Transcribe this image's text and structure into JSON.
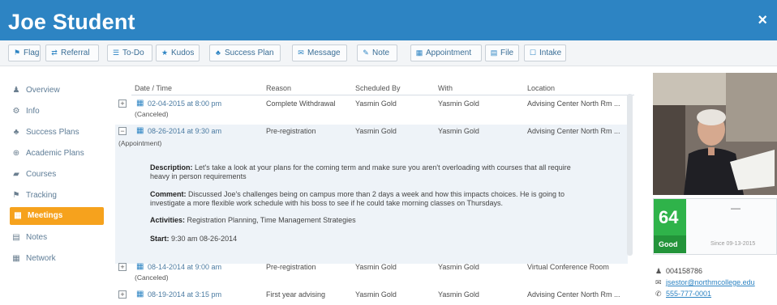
{
  "header": {
    "title": "Joe Student",
    "close_icon": "×"
  },
  "toolbar": {
    "buttons": [
      {
        "label": "Flag",
        "icon": "flag-icon"
      },
      {
        "label": "Referral",
        "icon": "referral-icon"
      },
      {
        "label": "To-Do",
        "icon": "todo-icon"
      },
      {
        "label": "Kudos",
        "icon": "star-icon"
      },
      {
        "label": "Success Plan",
        "icon": "success-plan-icon"
      },
      {
        "label": "Message",
        "icon": "message-icon"
      },
      {
        "label": "Note",
        "icon": "note-icon"
      },
      {
        "label": "Appointment",
        "icon": "appointment-icon"
      },
      {
        "label": "File",
        "icon": "file-icon"
      },
      {
        "label": "Intake",
        "icon": "intake-icon"
      }
    ]
  },
  "sidebar": {
    "items": [
      {
        "label": "Overview",
        "icon": "user-icon"
      },
      {
        "label": "Info",
        "icon": "info-icon"
      },
      {
        "label": "Success Plans",
        "icon": "plans-icon"
      },
      {
        "label": "Academic Plans",
        "icon": "academic-icon"
      },
      {
        "label": "Courses",
        "icon": "courses-icon"
      },
      {
        "label": "Tracking",
        "icon": "flag-icon"
      },
      {
        "label": "Meetings",
        "icon": "calendar-icon",
        "active": true
      },
      {
        "label": "Notes",
        "icon": "notes-icon"
      },
      {
        "label": "Network",
        "icon": "network-icon"
      }
    ]
  },
  "table": {
    "columns": [
      "Date / Time",
      "Reason",
      "Scheduled By",
      "With",
      "Location"
    ],
    "rows": [
      {
        "expand": "+",
        "datetime": "02-04-2015 at 8:00 pm",
        "status": "(Canceled)",
        "reason": "Complete Withdrawal",
        "scheduled_by": "Yasmin Gold",
        "with": "Yasmin Gold",
        "location": "Advising Center North Rm ..."
      },
      {
        "expand": "−",
        "datetime": "08-26-2014 at 9:30 am",
        "status": "(Appointment)",
        "reason": "Pre-registration",
        "scheduled_by": "Yasmin Gold",
        "with": "Yasmin Gold",
        "location": "Advising Center North Rm ..."
      },
      {
        "expand": "+",
        "datetime": "08-14-2014 at 9:00 am",
        "status": "(Canceled)",
        "reason": "Pre-registration",
        "scheduled_by": "Yasmin Gold",
        "with": "Yasmin Gold",
        "location": "Virtual Conference Room"
      },
      {
        "expand": "+",
        "datetime": "08-19-2014 at 3:15 pm",
        "status": "",
        "reason": "First year advising",
        "scheduled_by": "Yasmin Gold",
        "with": "Yasmin Gold",
        "location": "Advising Center North Rm ..."
      }
    ],
    "detail": {
      "description_label": "Description:",
      "description_line1": "Let's take a look at your plans for the coming term and make sure you aren't overloading with courses that all require",
      "description_line2": "heavy in person requirements",
      "comment_label": "Comment:",
      "comment_line1": "Discussed Joe's challenges being on campus more than 2 days a week and how this impacts choices. He is going to",
      "comment_line2": "investigate a more flexible work schedule with his boss to see if he could take morning classes on Thursdays.",
      "activities_label": "Activities:",
      "activities_value": "Registration Planning, Time Management Strategies",
      "start_label": "Start:",
      "start_value": "9:30 am 08-26-2014"
    }
  },
  "profile": {
    "score_value": "64",
    "score_label": "Good",
    "score_dash": "—",
    "score_date": "Since 09-13-2015",
    "student_id": "004158786",
    "email": "jsestor@northmcollege.edu",
    "phone": "555-777-0001"
  }
}
